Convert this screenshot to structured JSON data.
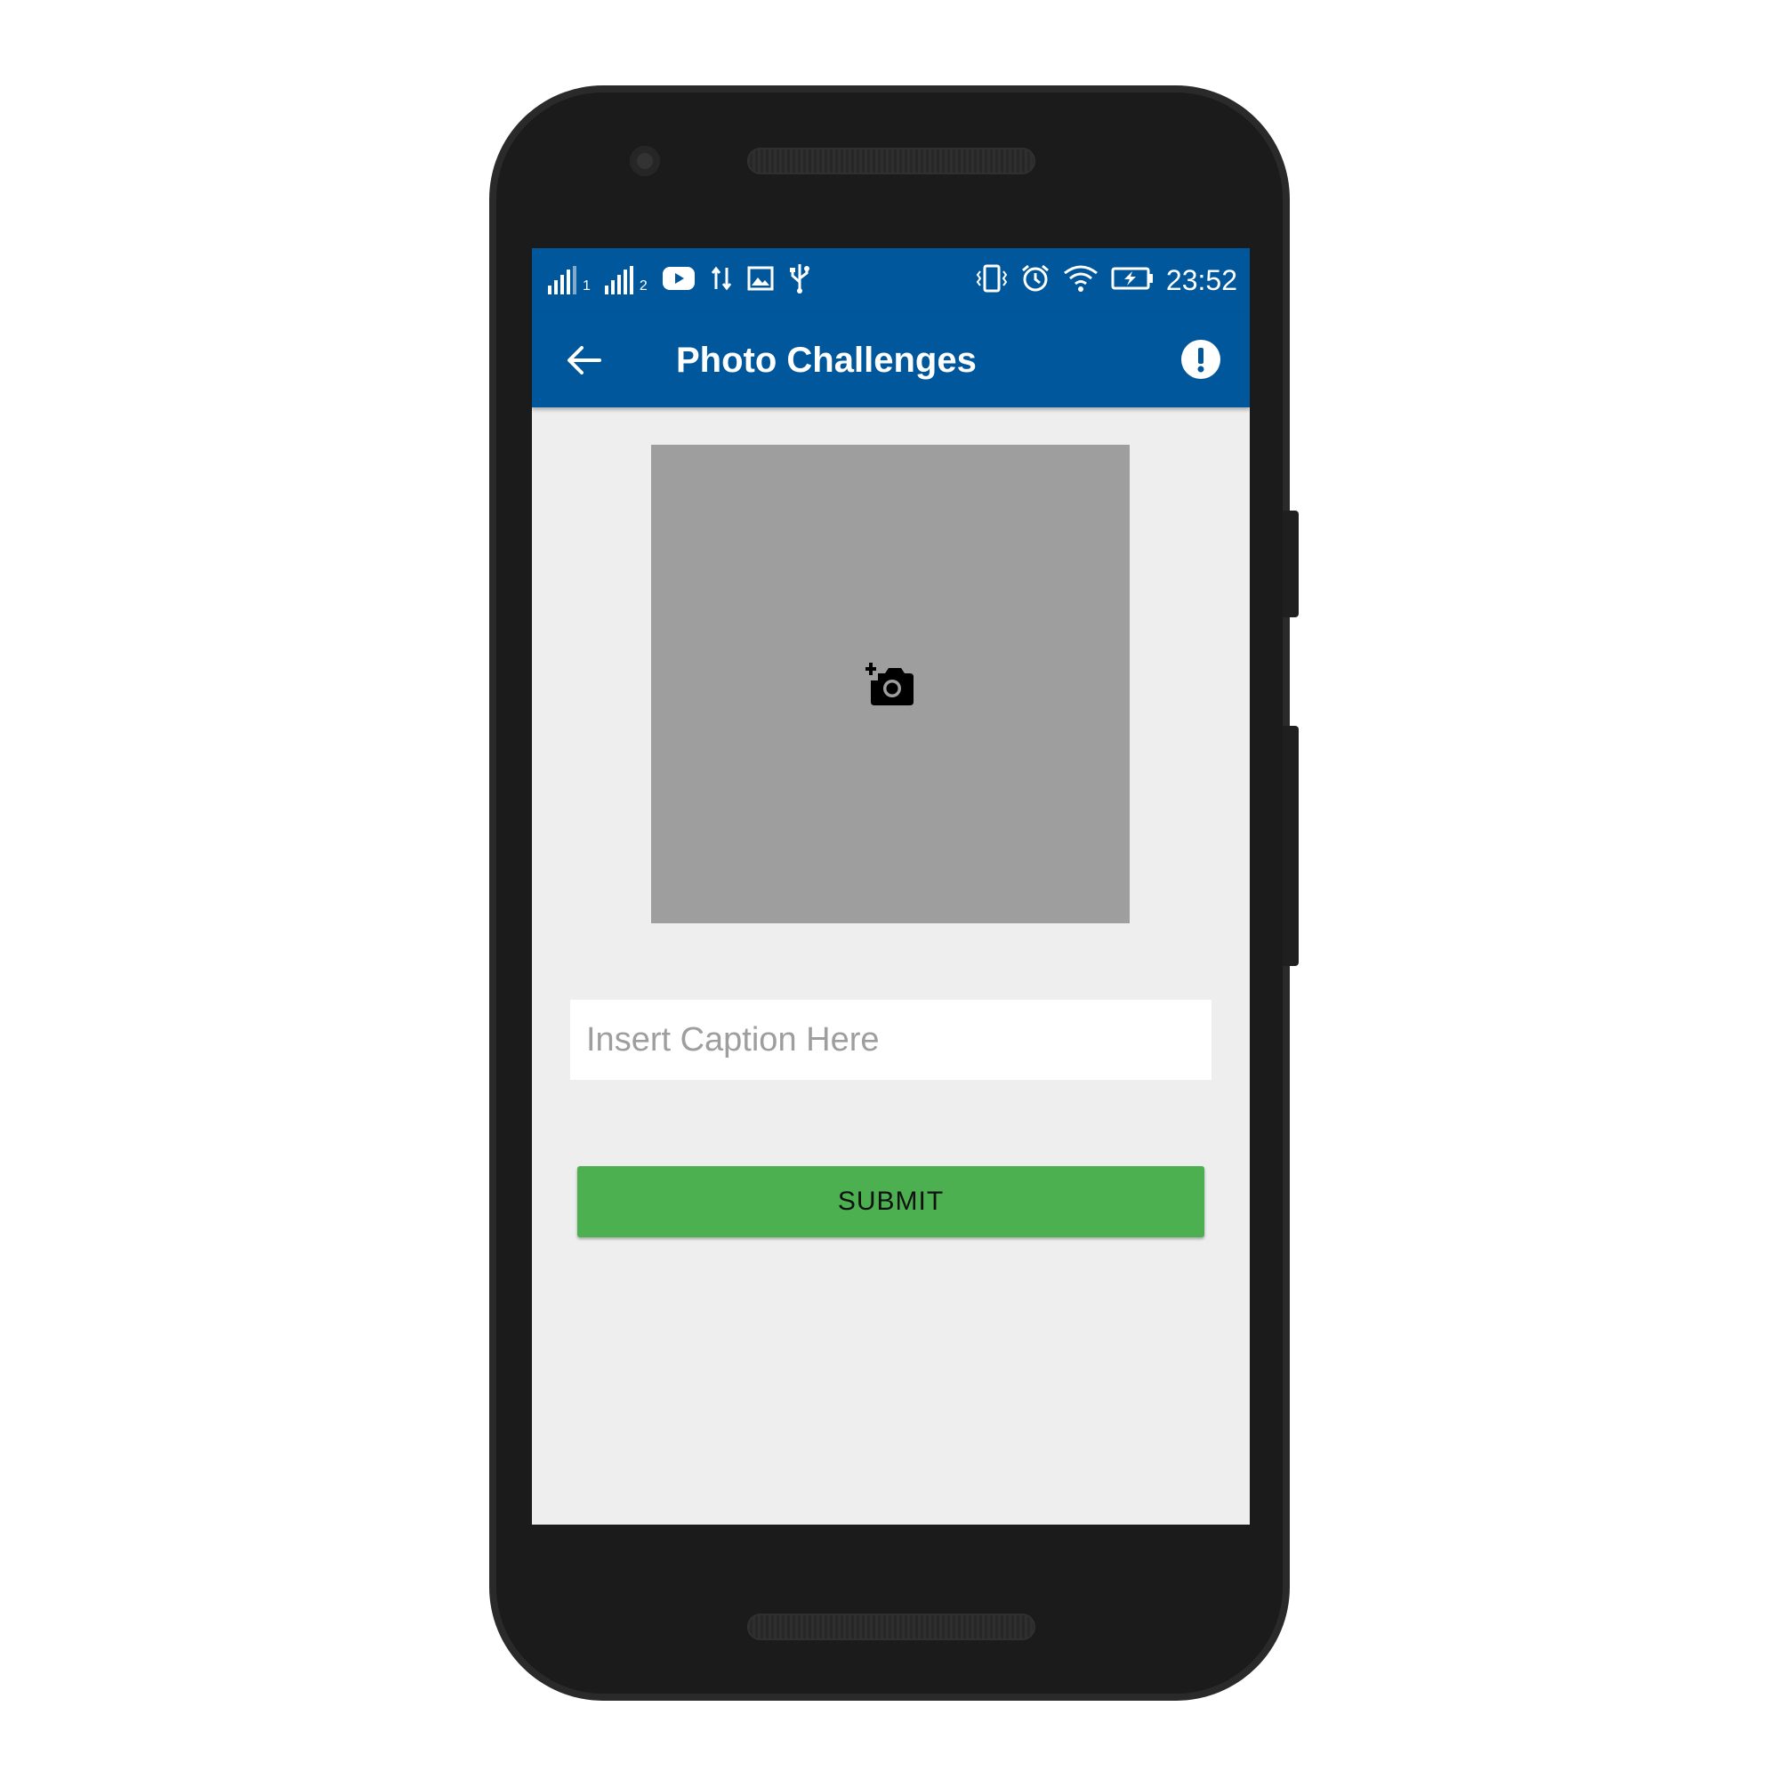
{
  "status_bar": {
    "sim1_label": "1",
    "sim2_label": "2",
    "time": "23:52",
    "icons": [
      "signal-icon",
      "signal-icon",
      "youtube-icon",
      "data-transfer-icon",
      "image-icon",
      "usb-icon",
      "vibrate-icon",
      "alarm-icon",
      "wifi-icon",
      "battery-charging-icon"
    ]
  },
  "app_bar": {
    "title": "Photo Challenges",
    "back_icon": "arrow-back-icon",
    "info_icon": "alert-circle-icon",
    "color": "#01579b"
  },
  "photo_area": {
    "icon": "add-a-photo-icon",
    "background": "#9e9e9e"
  },
  "caption": {
    "placeholder": "Insert Caption Here",
    "value": ""
  },
  "submit": {
    "label": "SUBMIT",
    "color": "#4caf50"
  }
}
